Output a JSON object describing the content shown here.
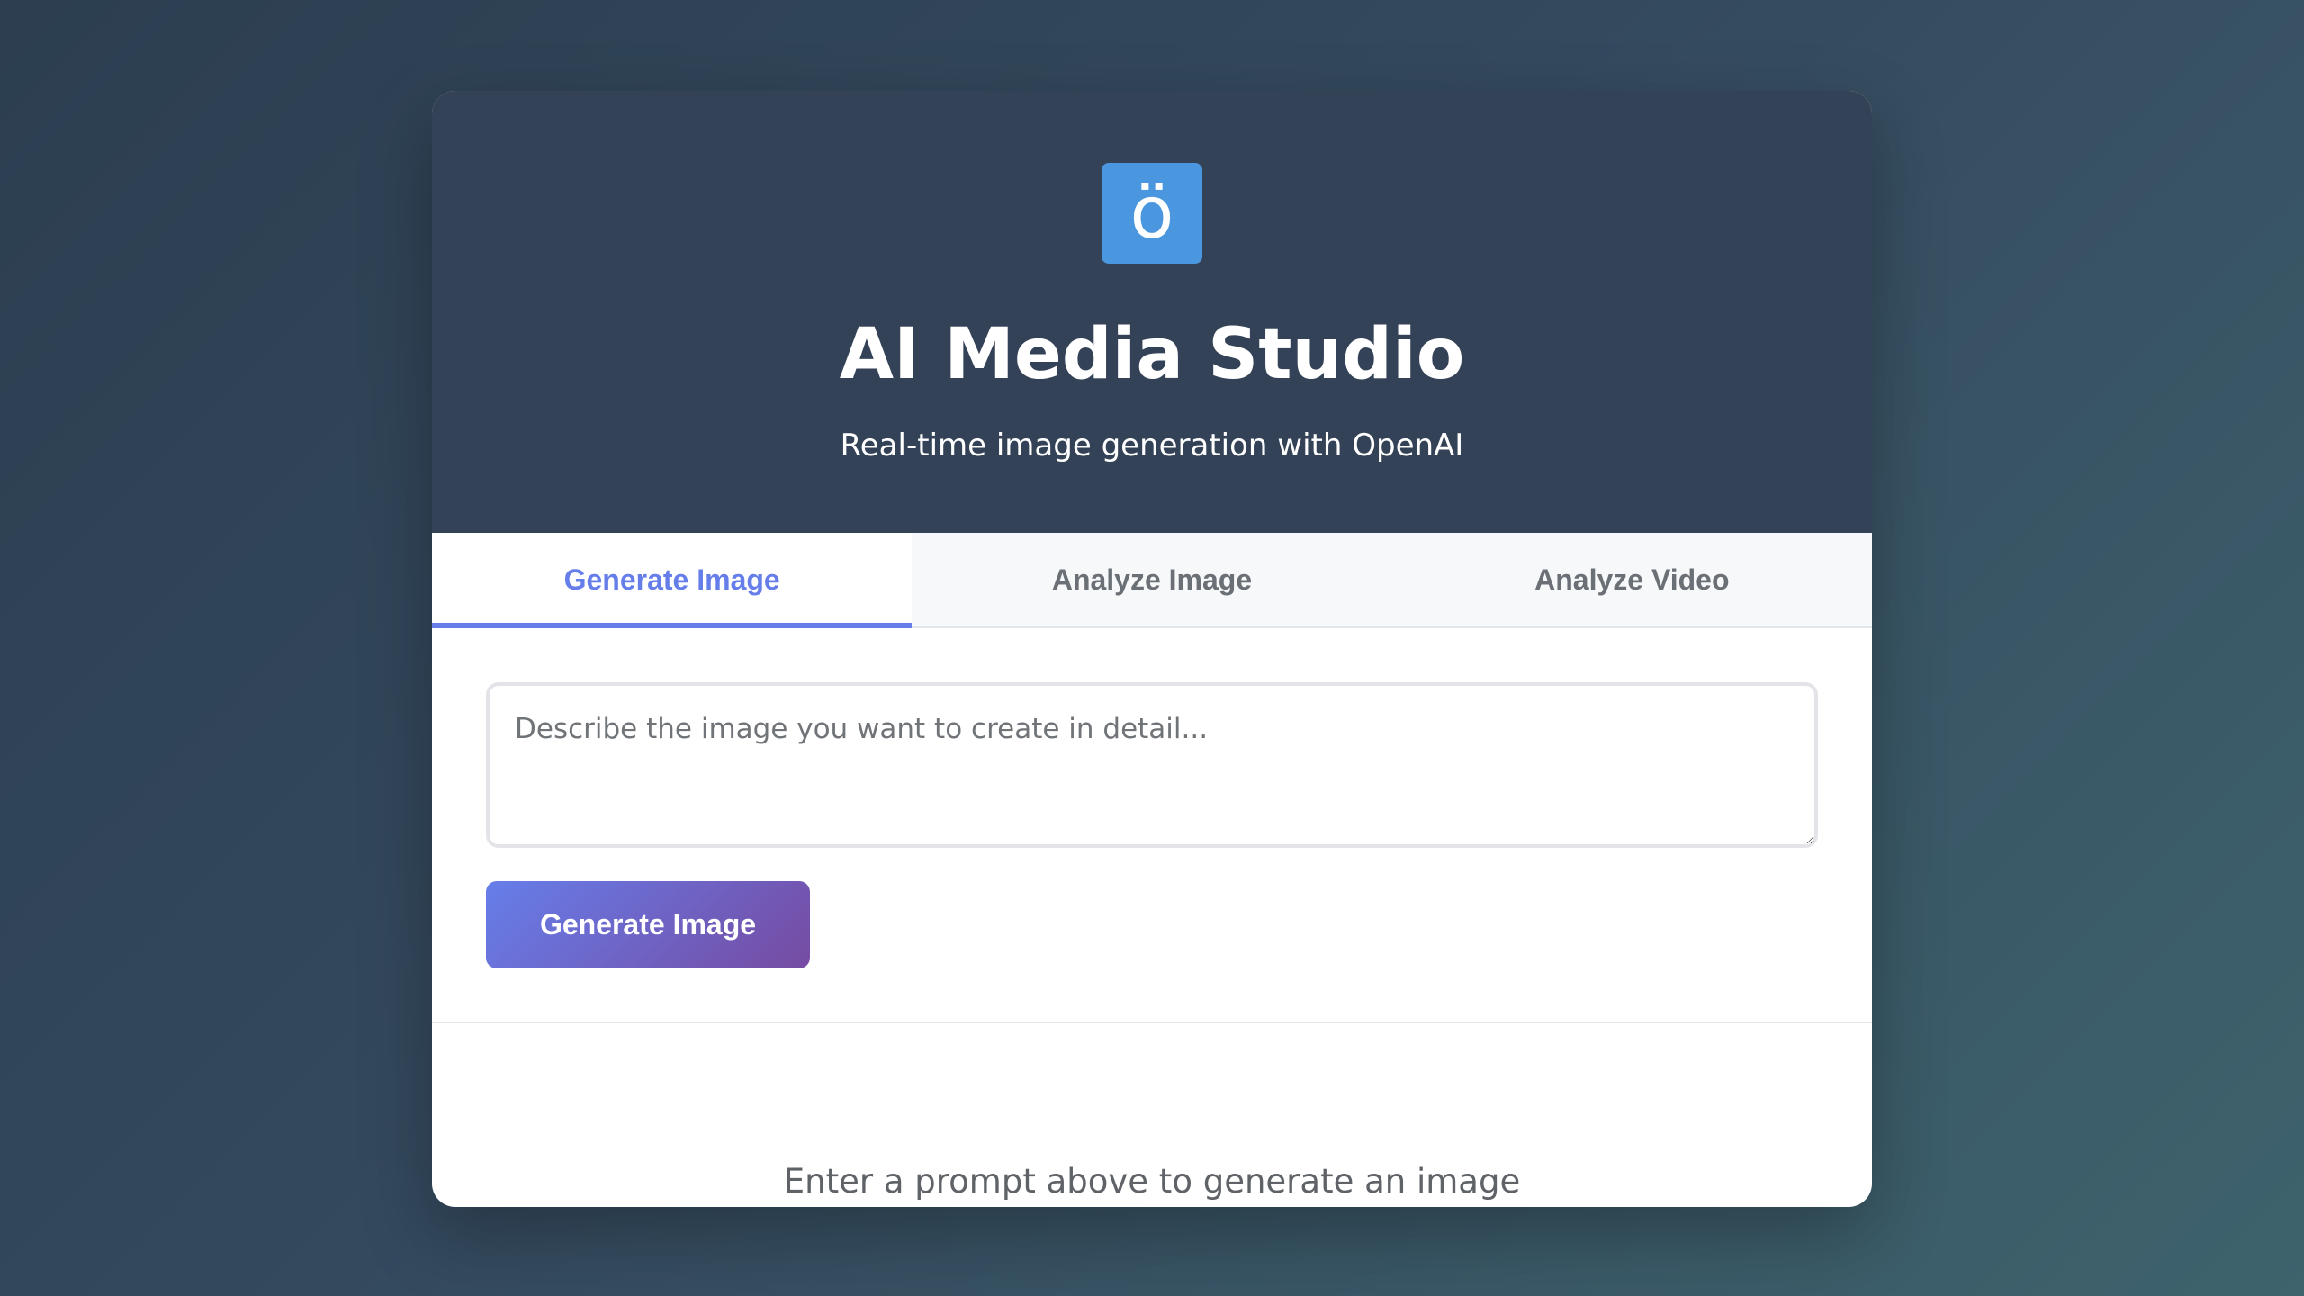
{
  "header": {
    "logo_glyph": "ö",
    "title": "AI Media Studio",
    "subtitle": "Real-time image generation with OpenAI"
  },
  "tabs": [
    {
      "label": "Generate Image",
      "active": true
    },
    {
      "label": "Analyze Image",
      "active": false
    },
    {
      "label": "Analyze Video",
      "active": false
    }
  ],
  "generate": {
    "prompt_value": "",
    "prompt_placeholder": "Describe the image you want to create in detail...",
    "button_label": "Generate Image"
  },
  "result": {
    "empty_message": "Enter a prompt above to generate an image"
  },
  "colors": {
    "accent": "#667eea",
    "accent_end": "#764ba2",
    "header_bg": "#344257",
    "logo_bg": "#4a97e0"
  }
}
